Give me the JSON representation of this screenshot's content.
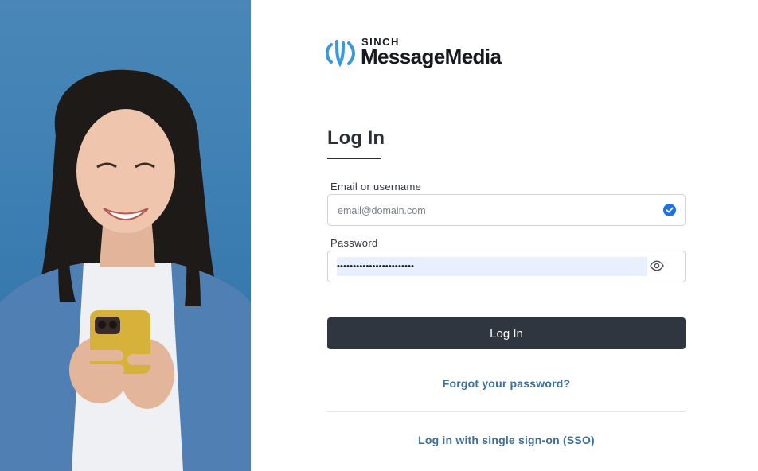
{
  "brand": {
    "company": "SINCH",
    "product": "MessageMedia",
    "logo_icon": "message-waves-icon",
    "accent_color": "#3a9ad9"
  },
  "hero": {
    "image": "woman-smiling-at-phone-photo",
    "background_color": "#3d7eb2"
  },
  "form": {
    "heading": "Log In",
    "email": {
      "label": "Email or username",
      "placeholder": "email@domain.com",
      "value": "",
      "status_icon": "check-circle-icon"
    },
    "password": {
      "label": "Password",
      "masked_value": "••••••••••••••••••••••••",
      "toggle_icon": "eye-icon"
    },
    "submit_label": "Log In",
    "forgot_password": "Forgot your password?",
    "sso_link": "Log in with single sign-on (SSO)"
  },
  "colors": {
    "button_bg": "#2f363f",
    "link": "#3c6f99",
    "autofill_bg": "#e8f0fe",
    "check": "#1a73e8"
  }
}
